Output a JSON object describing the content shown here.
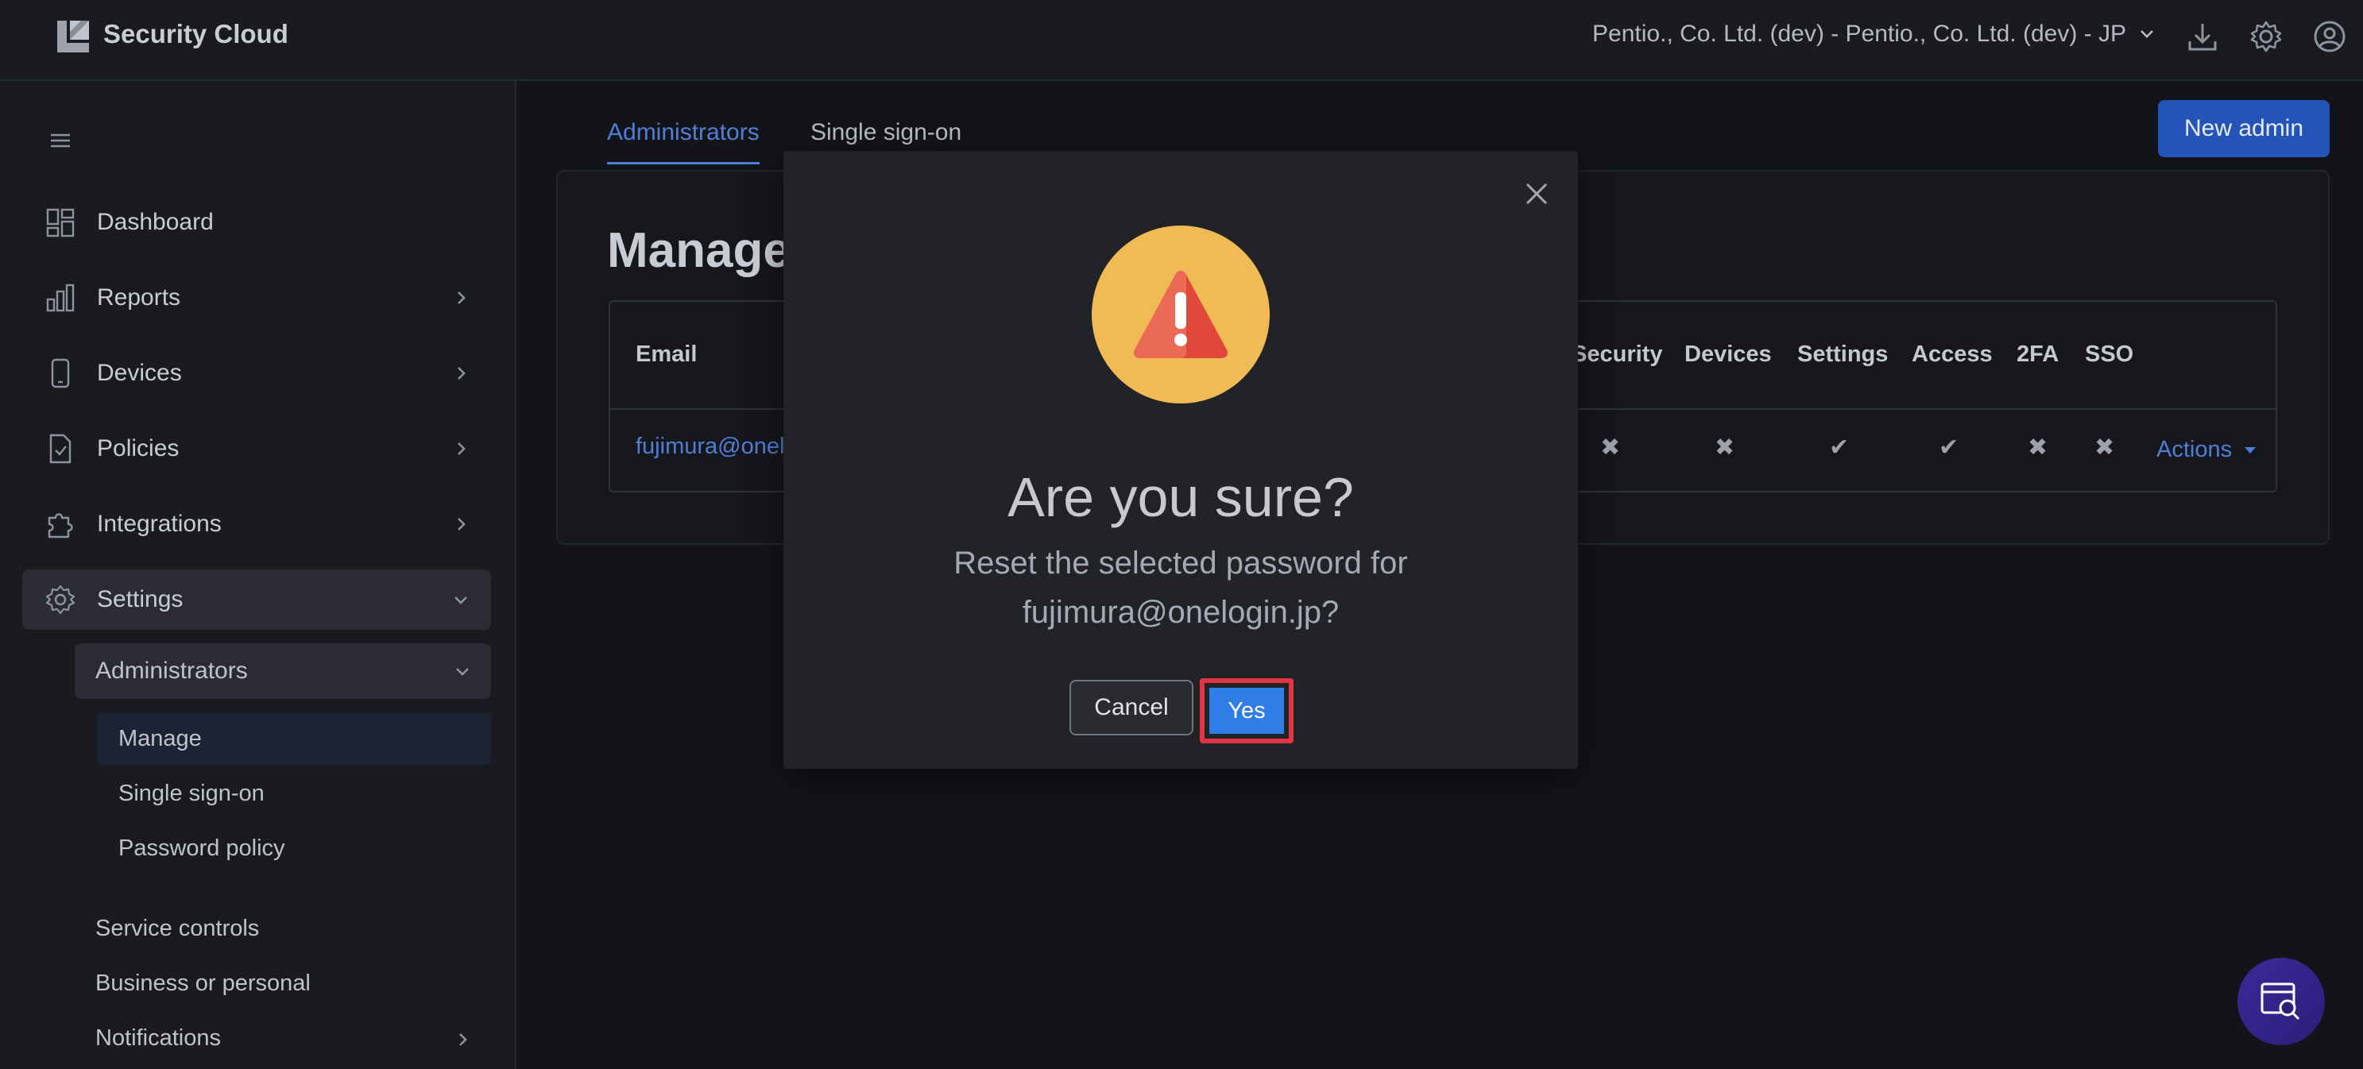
{
  "app": {
    "title": "Security Cloud"
  },
  "header": {
    "org": "Pentio., Co. Ltd. (dev) - Pentio., Co. Ltd. (dev) - JP"
  },
  "sidebar": {
    "items": [
      {
        "label": "Dashboard"
      },
      {
        "label": "Reports"
      },
      {
        "label": "Devices"
      },
      {
        "label": "Policies"
      },
      {
        "label": "Integrations"
      },
      {
        "label": "Settings"
      }
    ],
    "administrators": {
      "label": "Administrators",
      "children": [
        "Manage",
        "Single sign-on",
        "Password policy"
      ]
    },
    "more": [
      "Service controls",
      "Business or personal",
      "Notifications"
    ]
  },
  "tabs": [
    "Administrators",
    "Single sign-on"
  ],
  "new_admin_label": "New admin",
  "page_title": "Manage",
  "table": {
    "email_header": "Email",
    "columns": [
      "Security",
      "Devices",
      "Settings",
      "Access",
      "2FA",
      "SSO"
    ],
    "row": {
      "email": "fujimura@onel",
      "marks": [
        "✖",
        "✖",
        "✔",
        "✔",
        "✖",
        "✖"
      ],
      "actions_label": "Actions"
    }
  },
  "modal": {
    "title": "Are you sure?",
    "line1": "Reset the selected password for",
    "line2": "fujimura@onelogin.jp?",
    "cancel_label": "Cancel",
    "yes_label": "Yes"
  },
  "colors": {
    "accent": "#4f7fd4",
    "primary_button": "#2454b8",
    "confirm_button": "#2f7ee8",
    "highlight_outline": "#e03545",
    "warning_circle": "#f0bb55",
    "warning_triangle": "#e0483c"
  },
  "icons": {
    "logo": "security-cloud-logo",
    "download": "download-icon",
    "settings": "gear-icon",
    "account": "user-circle-icon",
    "menu": "hamburger-icon",
    "warning": "warning-triangle-icon",
    "fab": "search-report-icon"
  }
}
